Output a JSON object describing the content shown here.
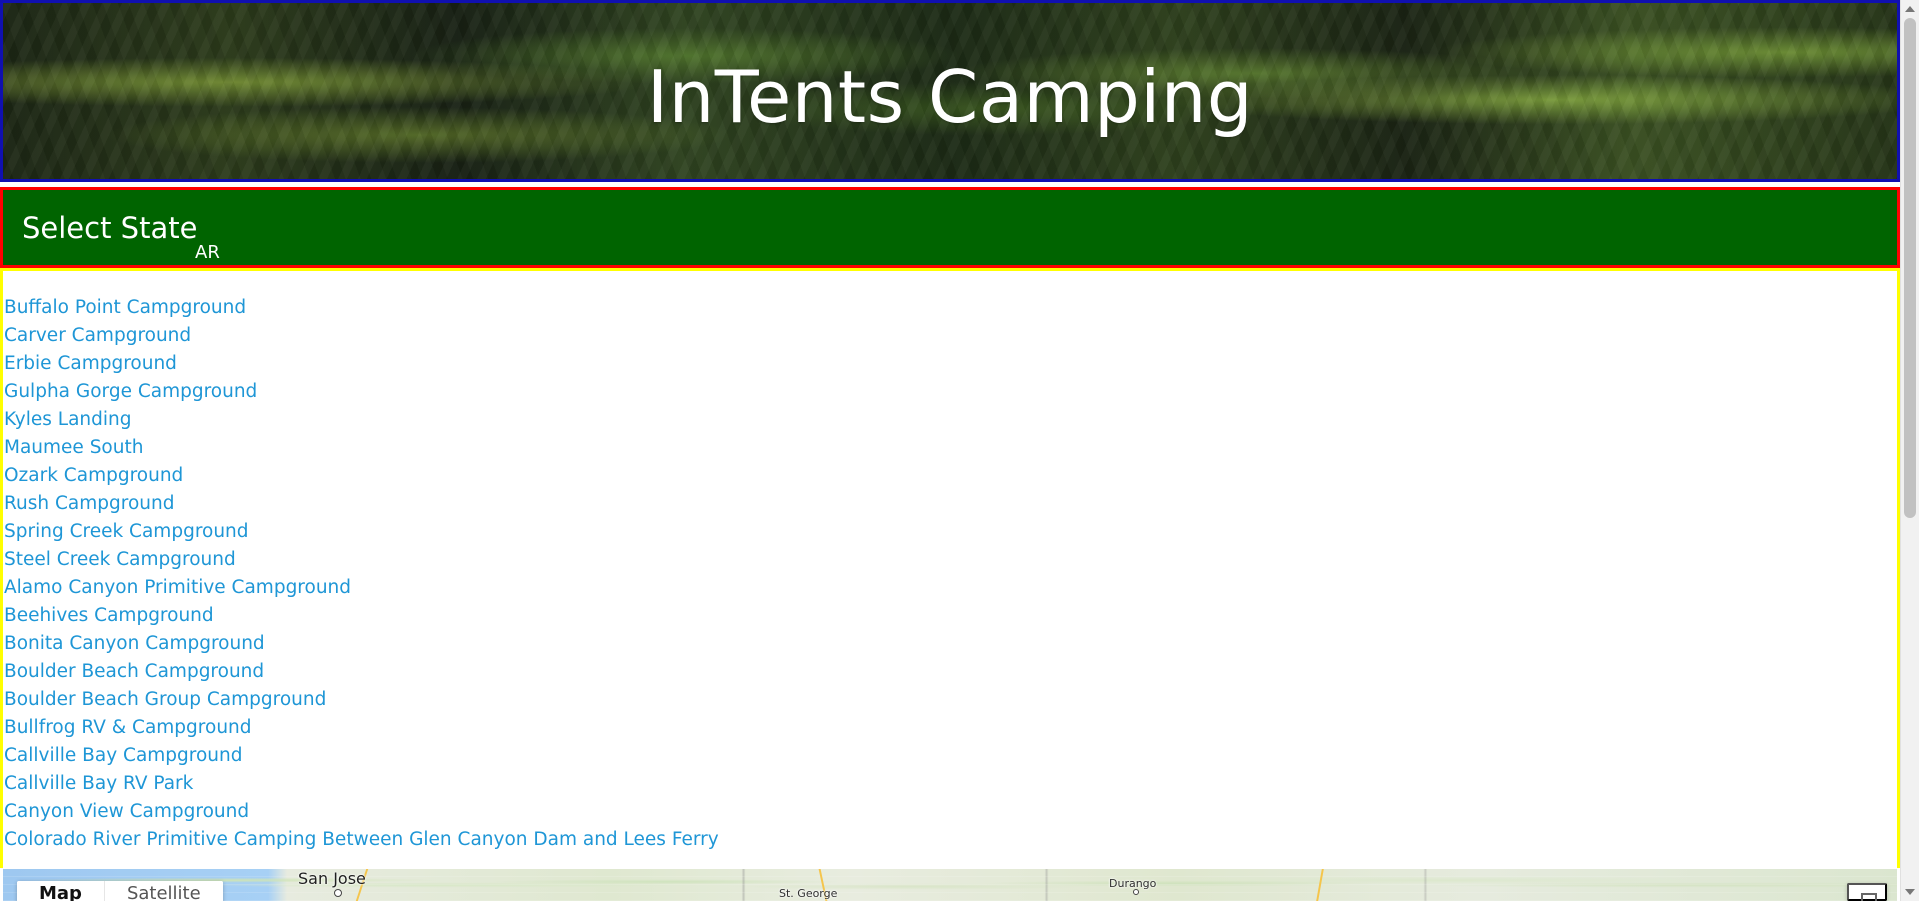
{
  "header": {
    "title": "InTents Camping"
  },
  "state_selector": {
    "label": "Select State",
    "value": "AR"
  },
  "campgrounds": [
    "Buffalo Point Campground",
    "Carver Campground",
    "Erbie Campground",
    "Gulpha Gorge Campground",
    "Kyles Landing",
    "Maumee South",
    "Ozark Campground",
    "Rush Campground",
    "Spring Creek Campground",
    "Steel Creek Campground",
    "Alamo Canyon Primitive Campground",
    "Beehives Campground",
    "Bonita Canyon Campground",
    "Boulder Beach Campground",
    "Boulder Beach Group Campground",
    "Bullfrog RV & Campground",
    "Callville Bay Campground",
    "Callville Bay RV Park",
    "Canyon View Campground",
    "Colorado River Primitive Camping Between Glen Canyon Dam and Lees Ferry"
  ],
  "map": {
    "cities": {
      "san_jose": "San Jose",
      "st_george": "St. George",
      "durango": "Durango"
    },
    "map_type_buttons": {
      "map": "Map",
      "satellite": "Satellite"
    }
  },
  "colors": {
    "header_border": "#1010b0",
    "state_bar_bg": "#006400",
    "state_bar_border": "#ff0000",
    "list_border": "#ffff00",
    "link": "#1e96d6"
  }
}
